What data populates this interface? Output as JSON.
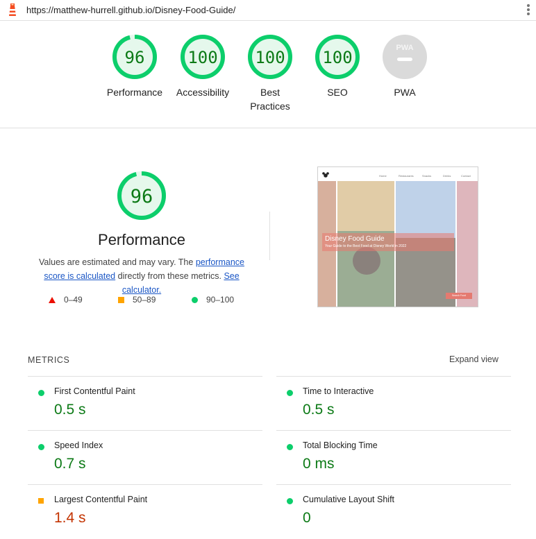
{
  "browser": {
    "url": "https://matthew-hurrell.github.io/Disney-Food-Guide/"
  },
  "gauges": [
    {
      "score": 96,
      "label": "Performance"
    },
    {
      "score": 100,
      "label": "Accessibility"
    },
    {
      "score": 100,
      "label": "Best Practices"
    },
    {
      "score": 100,
      "label": "SEO"
    },
    {
      "score": null,
      "label": "PWA",
      "badge": "PWA"
    }
  ],
  "performance": {
    "score": 96,
    "title": "Performance",
    "desc_prefix": "Values are estimated and may vary. The ",
    "link_score": "performance score is calculated",
    "desc_middle": " directly from these metrics. ",
    "link_calc": "See calculator.",
    "legend": [
      {
        "range": "0–49",
        "shape": "triangle",
        "color": "#eb0f00"
      },
      {
        "range": "50–89",
        "shape": "square",
        "color": "#ffa400"
      },
      {
        "range": "90–100",
        "shape": "circle",
        "color": "#0cce6b"
      }
    ]
  },
  "screenshot": {
    "title": "Disney Food Guide",
    "subtitle": "Your Guide to the Best Food at Disney World in 2022",
    "nav": [
      "Home",
      "Restaurants",
      "Snacks",
      "Drinks",
      "Contact"
    ],
    "button": "Search Food"
  },
  "metrics": {
    "heading": "METRICS",
    "expand": "Expand view",
    "items": [
      {
        "name": "First Contentful Paint",
        "value": "0.5 s",
        "rating": "pass"
      },
      {
        "name": "Time to Interactive",
        "value": "0.5 s",
        "rating": "pass"
      },
      {
        "name": "Speed Index",
        "value": "0.7 s",
        "rating": "pass"
      },
      {
        "name": "Total Blocking Time",
        "value": "0 ms",
        "rating": "pass"
      },
      {
        "name": "Largest Contentful Paint",
        "value": "1.4 s",
        "rating": "average"
      },
      {
        "name": "Cumulative Layout Shift",
        "value": "0",
        "rating": "pass"
      }
    ]
  },
  "colors": {
    "pass": "#0cce6b",
    "pass_text": "#0c7a16",
    "average": "#ffa400",
    "average_text": "#c33300",
    "fail": "#eb0f00",
    "na": "#cccccc"
  }
}
